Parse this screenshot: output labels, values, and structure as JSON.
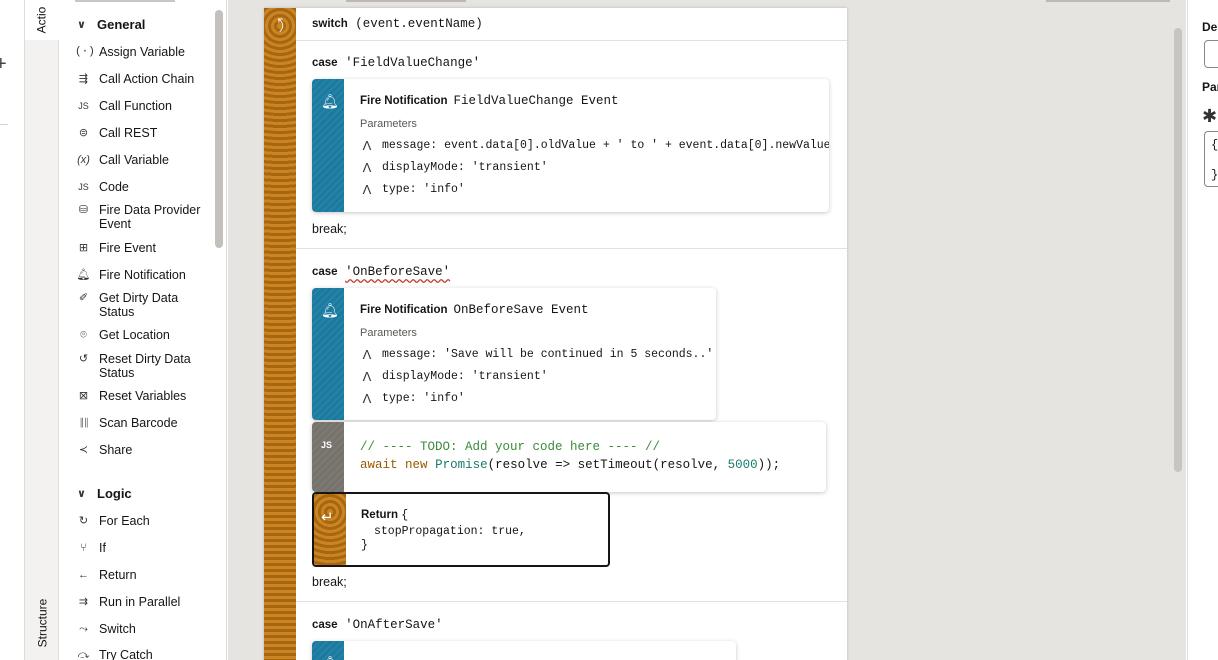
{
  "tabs": {
    "actions": "Actio",
    "structure": "Structure"
  },
  "palette": {
    "general": {
      "label": "General",
      "items": [
        {
          "label": "Assign Variable",
          "icon": "(·)"
        },
        {
          "label": "Call Action Chain",
          "icon": "⇶"
        },
        {
          "label": "Call Function",
          "icon": "JS"
        },
        {
          "label": "Call REST",
          "icon": "⊜"
        },
        {
          "label": "Call Variable",
          "icon": "(x)"
        },
        {
          "label": "Code",
          "icon": "JS"
        },
        {
          "label": "Fire Data Provider Event",
          "icon": "⛁"
        },
        {
          "label": "Fire Event",
          "icon": "⊞"
        },
        {
          "label": "Fire Notification",
          "icon": "🔔︎"
        },
        {
          "label": "Get Dirty Data Status",
          "icon": "✐"
        },
        {
          "label": "Get Location",
          "icon": "⌾"
        },
        {
          "label": "Reset Dirty Data Status",
          "icon": "↺"
        },
        {
          "label": "Reset Variables",
          "icon": "⊠"
        },
        {
          "label": "Scan Barcode",
          "icon": "║║"
        },
        {
          "label": "Share",
          "icon": "≺"
        }
      ]
    },
    "logic": {
      "label": "Logic",
      "items": [
        {
          "label": "For Each",
          "icon": "↻"
        },
        {
          "label": "If",
          "icon": "⑂"
        },
        {
          "label": "Return",
          "icon": "←"
        },
        {
          "label": "Run in Parallel",
          "icon": "⇉"
        },
        {
          "label": "Switch",
          "icon": "⤳"
        },
        {
          "label": "Try Catch",
          "icon": "⤼"
        }
      ]
    }
  },
  "flow": {
    "switch_kw": "switch",
    "switch_expr": "(event.eventName)",
    "case_kw": "case",
    "break_text": "break;",
    "params_label": "Parameters",
    "notif_kw": "Fire Notification",
    "case1": {
      "name": "'FieldValueChange'",
      "title": "FieldValueChange Event",
      "params": [
        "message: event.data[0].oldValue + ' to ' + event.data[0].newValue",
        "displayMode: 'transient'",
        "type: 'info'"
      ]
    },
    "case2": {
      "name": "'OnBeforeSave'",
      "title": "OnBeforeSave Event",
      "params": [
        "message: 'Save will be continued in 5 seconds..'",
        "displayMode: 'transient'",
        "type: 'info'"
      ],
      "code_badge": "JS",
      "code_comment": "// ---- TODO: Add your code here ---- //",
      "code_await": "await",
      "code_new": "new",
      "code_promise": "Promise",
      "code_mid": "(resolve => setTimeout(resolve, ",
      "code_num": "5000",
      "code_end": "));",
      "return_kw": "Return",
      "return_open": "{",
      "return_line": "stopPropagation: true,",
      "return_close": "}"
    },
    "case3": {
      "name": "'OnAfterSave'"
    }
  },
  "right_panel": {
    "label1": "De",
    "label2": "Par",
    "brace_open": "{",
    "brace_close": "}"
  }
}
